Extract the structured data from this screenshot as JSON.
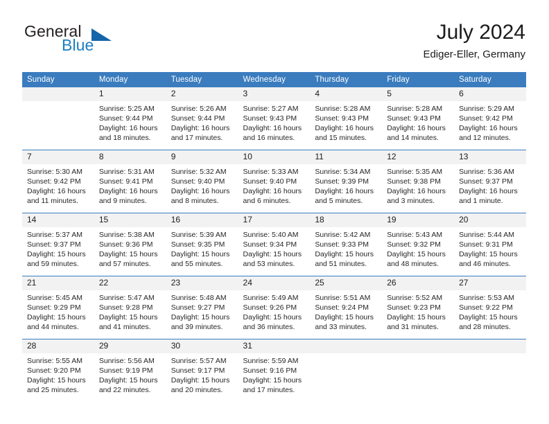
{
  "brand": {
    "name_part1": "General",
    "name_part2": "Blue",
    "triangle_color": "#1565a8",
    "blue_color": "#1a7fc1"
  },
  "header": {
    "month_title": "July 2024",
    "location": "Ediger-Eller, Germany",
    "header_bg_color": "#3a7cbe",
    "daynum_bg_color": "#f2f2f2"
  },
  "weekday_headers": [
    "Sunday",
    "Monday",
    "Tuesday",
    "Wednesday",
    "Thursday",
    "Friday",
    "Saturday"
  ],
  "weeks": [
    [
      {
        "day": "",
        "sunrise": "",
        "sunset": "",
        "daylight_line1": "",
        "daylight_line2": "",
        "empty": true
      },
      {
        "day": "1",
        "sunrise": "Sunrise: 5:25 AM",
        "sunset": "Sunset: 9:44 PM",
        "daylight_line1": "Daylight: 16 hours",
        "daylight_line2": "and 18 minutes.",
        "empty": false
      },
      {
        "day": "2",
        "sunrise": "Sunrise: 5:26 AM",
        "sunset": "Sunset: 9:44 PM",
        "daylight_line1": "Daylight: 16 hours",
        "daylight_line2": "and 17 minutes.",
        "empty": false
      },
      {
        "day": "3",
        "sunrise": "Sunrise: 5:27 AM",
        "sunset": "Sunset: 9:43 PM",
        "daylight_line1": "Daylight: 16 hours",
        "daylight_line2": "and 16 minutes.",
        "empty": false
      },
      {
        "day": "4",
        "sunrise": "Sunrise: 5:28 AM",
        "sunset": "Sunset: 9:43 PM",
        "daylight_line1": "Daylight: 16 hours",
        "daylight_line2": "and 15 minutes.",
        "empty": false
      },
      {
        "day": "5",
        "sunrise": "Sunrise: 5:28 AM",
        "sunset": "Sunset: 9:43 PM",
        "daylight_line1": "Daylight: 16 hours",
        "daylight_line2": "and 14 minutes.",
        "empty": false
      },
      {
        "day": "6",
        "sunrise": "Sunrise: 5:29 AM",
        "sunset": "Sunset: 9:42 PM",
        "daylight_line1": "Daylight: 16 hours",
        "daylight_line2": "and 12 minutes.",
        "empty": false
      }
    ],
    [
      {
        "day": "7",
        "sunrise": "Sunrise: 5:30 AM",
        "sunset": "Sunset: 9:42 PM",
        "daylight_line1": "Daylight: 16 hours",
        "daylight_line2": "and 11 minutes.",
        "empty": false
      },
      {
        "day": "8",
        "sunrise": "Sunrise: 5:31 AM",
        "sunset": "Sunset: 9:41 PM",
        "daylight_line1": "Daylight: 16 hours",
        "daylight_line2": "and 9 minutes.",
        "empty": false
      },
      {
        "day": "9",
        "sunrise": "Sunrise: 5:32 AM",
        "sunset": "Sunset: 9:40 PM",
        "daylight_line1": "Daylight: 16 hours",
        "daylight_line2": "and 8 minutes.",
        "empty": false
      },
      {
        "day": "10",
        "sunrise": "Sunrise: 5:33 AM",
        "sunset": "Sunset: 9:40 PM",
        "daylight_line1": "Daylight: 16 hours",
        "daylight_line2": "and 6 minutes.",
        "empty": false
      },
      {
        "day": "11",
        "sunrise": "Sunrise: 5:34 AM",
        "sunset": "Sunset: 9:39 PM",
        "daylight_line1": "Daylight: 16 hours",
        "daylight_line2": "and 5 minutes.",
        "empty": false
      },
      {
        "day": "12",
        "sunrise": "Sunrise: 5:35 AM",
        "sunset": "Sunset: 9:38 PM",
        "daylight_line1": "Daylight: 16 hours",
        "daylight_line2": "and 3 minutes.",
        "empty": false
      },
      {
        "day": "13",
        "sunrise": "Sunrise: 5:36 AM",
        "sunset": "Sunset: 9:37 PM",
        "daylight_line1": "Daylight: 16 hours",
        "daylight_line2": "and 1 minute.",
        "empty": false
      }
    ],
    [
      {
        "day": "14",
        "sunrise": "Sunrise: 5:37 AM",
        "sunset": "Sunset: 9:37 PM",
        "daylight_line1": "Daylight: 15 hours",
        "daylight_line2": "and 59 minutes.",
        "empty": false
      },
      {
        "day": "15",
        "sunrise": "Sunrise: 5:38 AM",
        "sunset": "Sunset: 9:36 PM",
        "daylight_line1": "Daylight: 15 hours",
        "daylight_line2": "and 57 minutes.",
        "empty": false
      },
      {
        "day": "16",
        "sunrise": "Sunrise: 5:39 AM",
        "sunset": "Sunset: 9:35 PM",
        "daylight_line1": "Daylight: 15 hours",
        "daylight_line2": "and 55 minutes.",
        "empty": false
      },
      {
        "day": "17",
        "sunrise": "Sunrise: 5:40 AM",
        "sunset": "Sunset: 9:34 PM",
        "daylight_line1": "Daylight: 15 hours",
        "daylight_line2": "and 53 minutes.",
        "empty": false
      },
      {
        "day": "18",
        "sunrise": "Sunrise: 5:42 AM",
        "sunset": "Sunset: 9:33 PM",
        "daylight_line1": "Daylight: 15 hours",
        "daylight_line2": "and 51 minutes.",
        "empty": false
      },
      {
        "day": "19",
        "sunrise": "Sunrise: 5:43 AM",
        "sunset": "Sunset: 9:32 PM",
        "daylight_line1": "Daylight: 15 hours",
        "daylight_line2": "and 48 minutes.",
        "empty": false
      },
      {
        "day": "20",
        "sunrise": "Sunrise: 5:44 AM",
        "sunset": "Sunset: 9:31 PM",
        "daylight_line1": "Daylight: 15 hours",
        "daylight_line2": "and 46 minutes.",
        "empty": false
      }
    ],
    [
      {
        "day": "21",
        "sunrise": "Sunrise: 5:45 AM",
        "sunset": "Sunset: 9:29 PM",
        "daylight_line1": "Daylight: 15 hours",
        "daylight_line2": "and 44 minutes.",
        "empty": false
      },
      {
        "day": "22",
        "sunrise": "Sunrise: 5:47 AM",
        "sunset": "Sunset: 9:28 PM",
        "daylight_line1": "Daylight: 15 hours",
        "daylight_line2": "and 41 minutes.",
        "empty": false
      },
      {
        "day": "23",
        "sunrise": "Sunrise: 5:48 AM",
        "sunset": "Sunset: 9:27 PM",
        "daylight_line1": "Daylight: 15 hours",
        "daylight_line2": "and 39 minutes.",
        "empty": false
      },
      {
        "day": "24",
        "sunrise": "Sunrise: 5:49 AM",
        "sunset": "Sunset: 9:26 PM",
        "daylight_line1": "Daylight: 15 hours",
        "daylight_line2": "and 36 minutes.",
        "empty": false
      },
      {
        "day": "25",
        "sunrise": "Sunrise: 5:51 AM",
        "sunset": "Sunset: 9:24 PM",
        "daylight_line1": "Daylight: 15 hours",
        "daylight_line2": "and 33 minutes.",
        "empty": false
      },
      {
        "day": "26",
        "sunrise": "Sunrise: 5:52 AM",
        "sunset": "Sunset: 9:23 PM",
        "daylight_line1": "Daylight: 15 hours",
        "daylight_line2": "and 31 minutes.",
        "empty": false
      },
      {
        "day": "27",
        "sunrise": "Sunrise: 5:53 AM",
        "sunset": "Sunset: 9:22 PM",
        "daylight_line1": "Daylight: 15 hours",
        "daylight_line2": "and 28 minutes.",
        "empty": false
      }
    ],
    [
      {
        "day": "28",
        "sunrise": "Sunrise: 5:55 AM",
        "sunset": "Sunset: 9:20 PM",
        "daylight_line1": "Daylight: 15 hours",
        "daylight_line2": "and 25 minutes.",
        "empty": false
      },
      {
        "day": "29",
        "sunrise": "Sunrise: 5:56 AM",
        "sunset": "Sunset: 9:19 PM",
        "daylight_line1": "Daylight: 15 hours",
        "daylight_line2": "and 22 minutes.",
        "empty": false
      },
      {
        "day": "30",
        "sunrise": "Sunrise: 5:57 AM",
        "sunset": "Sunset: 9:17 PM",
        "daylight_line1": "Daylight: 15 hours",
        "daylight_line2": "and 20 minutes.",
        "empty": false
      },
      {
        "day": "31",
        "sunrise": "Sunrise: 5:59 AM",
        "sunset": "Sunset: 9:16 PM",
        "daylight_line1": "Daylight: 15 hours",
        "daylight_line2": "and 17 minutes.",
        "empty": false
      },
      {
        "day": "",
        "sunrise": "",
        "sunset": "",
        "daylight_line1": "",
        "daylight_line2": "",
        "empty": true
      },
      {
        "day": "",
        "sunrise": "",
        "sunset": "",
        "daylight_line1": "",
        "daylight_line2": "",
        "empty": true
      },
      {
        "day": "",
        "sunrise": "",
        "sunset": "",
        "daylight_line1": "",
        "daylight_line2": "",
        "empty": true
      }
    ]
  ]
}
